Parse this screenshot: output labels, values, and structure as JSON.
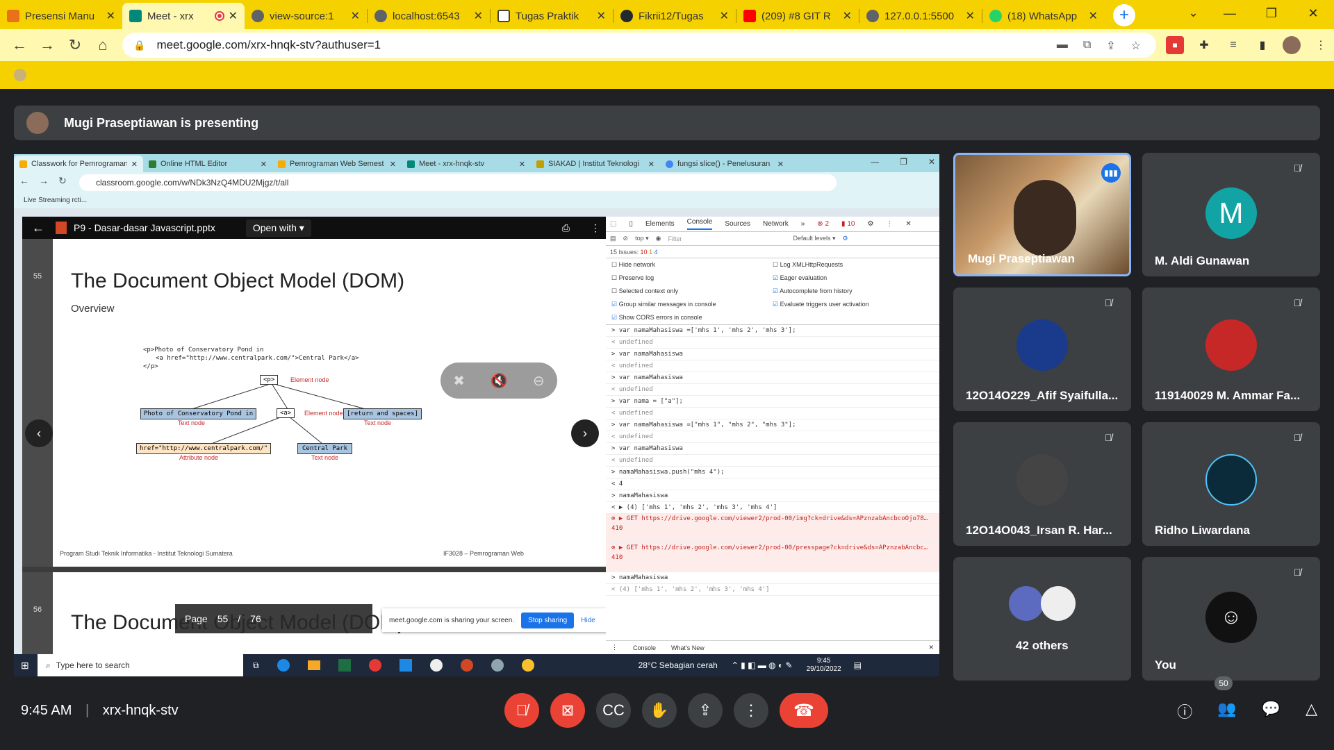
{
  "browser": {
    "tabs": [
      {
        "label": "Presensi Manu",
        "color": "#e8711a"
      },
      {
        "label": "Meet - xrx",
        "color": "#00897b"
      },
      {
        "label": "view-source:1",
        "color": "#5f6368"
      },
      {
        "label": "localhost:6543",
        "color": "#5f6368"
      },
      {
        "label": "Tugas Praktik",
        "color": "#5f6368"
      },
      {
        "label": "Fikrii12/Tugas",
        "color": "#24292e"
      },
      {
        "label": "(209) #8 GIT R",
        "color": "#ff0000"
      },
      {
        "label": "127.0.0.1:5500",
        "color": "#5f6368"
      },
      {
        "label": "(18) WhatsApp",
        "color": "#25d366"
      }
    ],
    "url": "meet.google.com/xrx-hnqk-stv?authuser=1"
  },
  "meet": {
    "presenter_text": "Mugi Praseptiawan is presenting",
    "meeting_time": "9:45 AM",
    "meeting_code": "xrx-hnqk-stv",
    "participant_count": "50"
  },
  "shared": {
    "tabs": [
      "Classwork for Pemrograman",
      "Online HTML Editor",
      "Pemrograman Web Semest",
      "Meet - xrx-hnqk-stv",
      "SIAKAD | Institut Teknologi",
      "fungsi slice() - Penelusuran"
    ],
    "url": "classroom.google.com/w/NDk3NzQ4MDU2Mjgz/t/all",
    "bookmark": "Live Streaming rcti...",
    "file_name": "P9 - Dasar-dasar Javascript.pptx",
    "open_with": "Open with",
    "slide_header_left": "Program Studi Teknik Informatika - Institut Teknologi Sumatera",
    "slide_header_right": "IF3028 – Pemrograman Web",
    "slide_number": "55",
    "slide_title": "The Document Object Model (DOM)",
    "slide_subtitle": "Overview",
    "code_line1": "<p>Photo of Conservatory Pond in",
    "code_line2": "<a href=\"http://www.centralpark.com/\">Central Park</a>",
    "code_line3": "</p>",
    "node_p": "<p>",
    "node_p_label": "Element node",
    "node_text1": "Photo of Conservatory Pond in",
    "node_text1_label": "Text node",
    "node_a": "<a>",
    "node_a_label": "Element node",
    "node_text2": "[return and spaces]",
    "node_text2_label": "Text node",
    "node_href": "href=\"http://www.centralpark.com/\"",
    "node_href_label": "Attribute node",
    "node_cp": "Central Park",
    "node_cp_label": "Text node",
    "footer_left": "Program Studi Teknik Informatika - Institut Teknologi Sumatera",
    "footer_right": "IF3028 – Pemrograman Web",
    "slide2_number": "56",
    "slide2_title": "The Document Object Model (DOM)",
    "page_label": "Page",
    "page_current": "55",
    "page_sep": "/",
    "page_total": "76",
    "sharing_text": "meet.google.com is sharing your screen.",
    "stop_sharing": "Stop sharing",
    "hide": "Hide",
    "devtools_tabs": [
      "Elements",
      "Console",
      "Sources",
      "Network"
    ],
    "devtools_errors": "2",
    "devtools_warnings": "10",
    "devtools_context": "top",
    "devtools_filter": "Filter",
    "devtools_levels": "Default levels",
    "issues_text": "15 Issues:",
    "issues_counts": [
      "10",
      "1",
      "4"
    ],
    "settings": [
      "Hide network",
      "Log XMLHttpRequests",
      "Preserve log",
      "Eager evaluation",
      "Selected context only",
      "Autocomplete from history",
      "Group similar messages in console",
      "Evaluate triggers user activation",
      "Show CORS errors in console"
    ],
    "console": [
      "var namaMahasiswa =['mhs 1', 'mhs 2', 'mhs 3'];",
      "undefined",
      "var namaMahasiswa",
      "undefined",
      "var namaMahasiswa",
      "undefined",
      "var nama = [\"a\"];",
      "undefined",
      "var namaMahasiswa =[\"mhs 1\", \"mhs 2\", \"mhs 3\"];",
      "undefined",
      "var namaMahasiswa",
      "undefined",
      "namaMahasiswa.push(\"mhs 4\");",
      "4",
      "namaMahasiswa",
      "▶ (4) ['mhs 1', 'mhs 2', 'mhs 3', 'mhs 4']"
    ],
    "error1": "▶ GET https://drive.google.com/viewer2/prod-00/img?ck=drive&ds=APznzabAncbcoOjo78… 410",
    "error2": "▶ GET https://drive.google.com/viewer2/prod-00/presspage?ck=drive&ds=APznzabAncbc… 410",
    "console_after": [
      "namaMahasiswa",
      "(4) ['mhs 1', 'mhs 2', 'mhs 3', 'mhs 4']"
    ],
    "drawer_tabs": [
      "Console",
      "What's New"
    ],
    "taskbar_search": "Type here to search",
    "weather": "28°C  Sebagian cerah",
    "time": "9:45",
    "date": "29/10/2022"
  },
  "participants": [
    {
      "name": "Mugi Praseptiawan",
      "type": "video"
    },
    {
      "name": "M. Aldi Gunawan",
      "initial": "M",
      "color": "#12a4a5"
    },
    {
      "name": "12O14O229_Afif Syaifulla...",
      "color": "#1a3a8c"
    },
    {
      "name": "119140029 M. Ammar Fa...",
      "color": "#c62828"
    },
    {
      "name": "12O14O043_Irsan R. Har...",
      "color": "#444"
    },
    {
      "name": "Ridho Liwardana",
      "color": "#0b2a3a"
    },
    {
      "name": "42 others",
      "color": "#555"
    },
    {
      "name": "You",
      "color": "#111"
    }
  ]
}
